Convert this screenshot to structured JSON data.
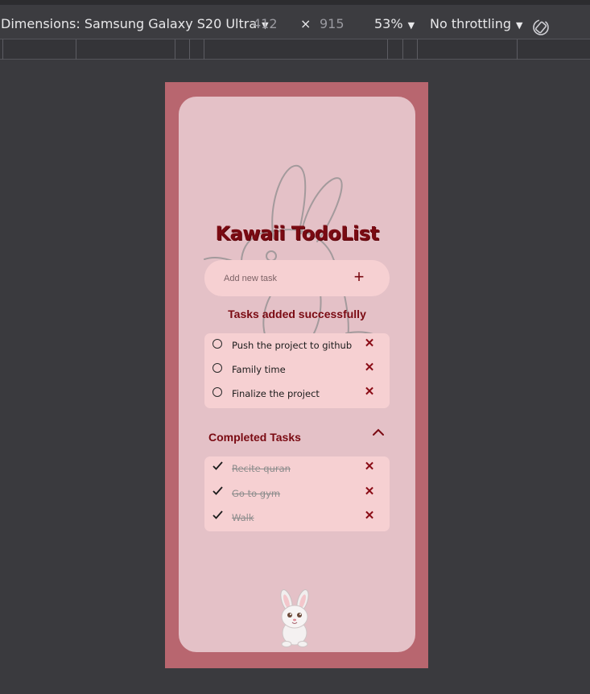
{
  "devtools": {
    "device_label": "Dimensions: Samsung Galaxy S20 Ultra",
    "width": "412",
    "times": "×",
    "height": "915",
    "zoom": "53%",
    "throttling": "No throttling",
    "icons": {
      "dropdown": "caret-down-icon",
      "rotate": "rotate-icon"
    }
  },
  "app": {
    "title": "Kawaii TodoList",
    "add_task": {
      "placeholder": "Add new task",
      "value": "",
      "button_label": "+"
    },
    "status_message": "Tasks added successfully",
    "tasks": [
      {
        "text": "Push the project to github",
        "done": false
      },
      {
        "text": "Family time",
        "done": false
      },
      {
        "text": "Finalize the project",
        "done": false
      }
    ],
    "completed_section": {
      "title": "Completed Tasks",
      "expanded": true,
      "tasks": [
        {
          "text": "Recite quran",
          "done": true
        },
        {
          "text": "Go to gym",
          "done": true
        },
        {
          "text": "Walk",
          "done": true
        }
      ]
    },
    "delete_label": "✕",
    "colors": {
      "frame": "#b8666f",
      "card": "#e4c1c7",
      "panel": "#f6d0d2",
      "accent": "#7a0a12"
    }
  }
}
